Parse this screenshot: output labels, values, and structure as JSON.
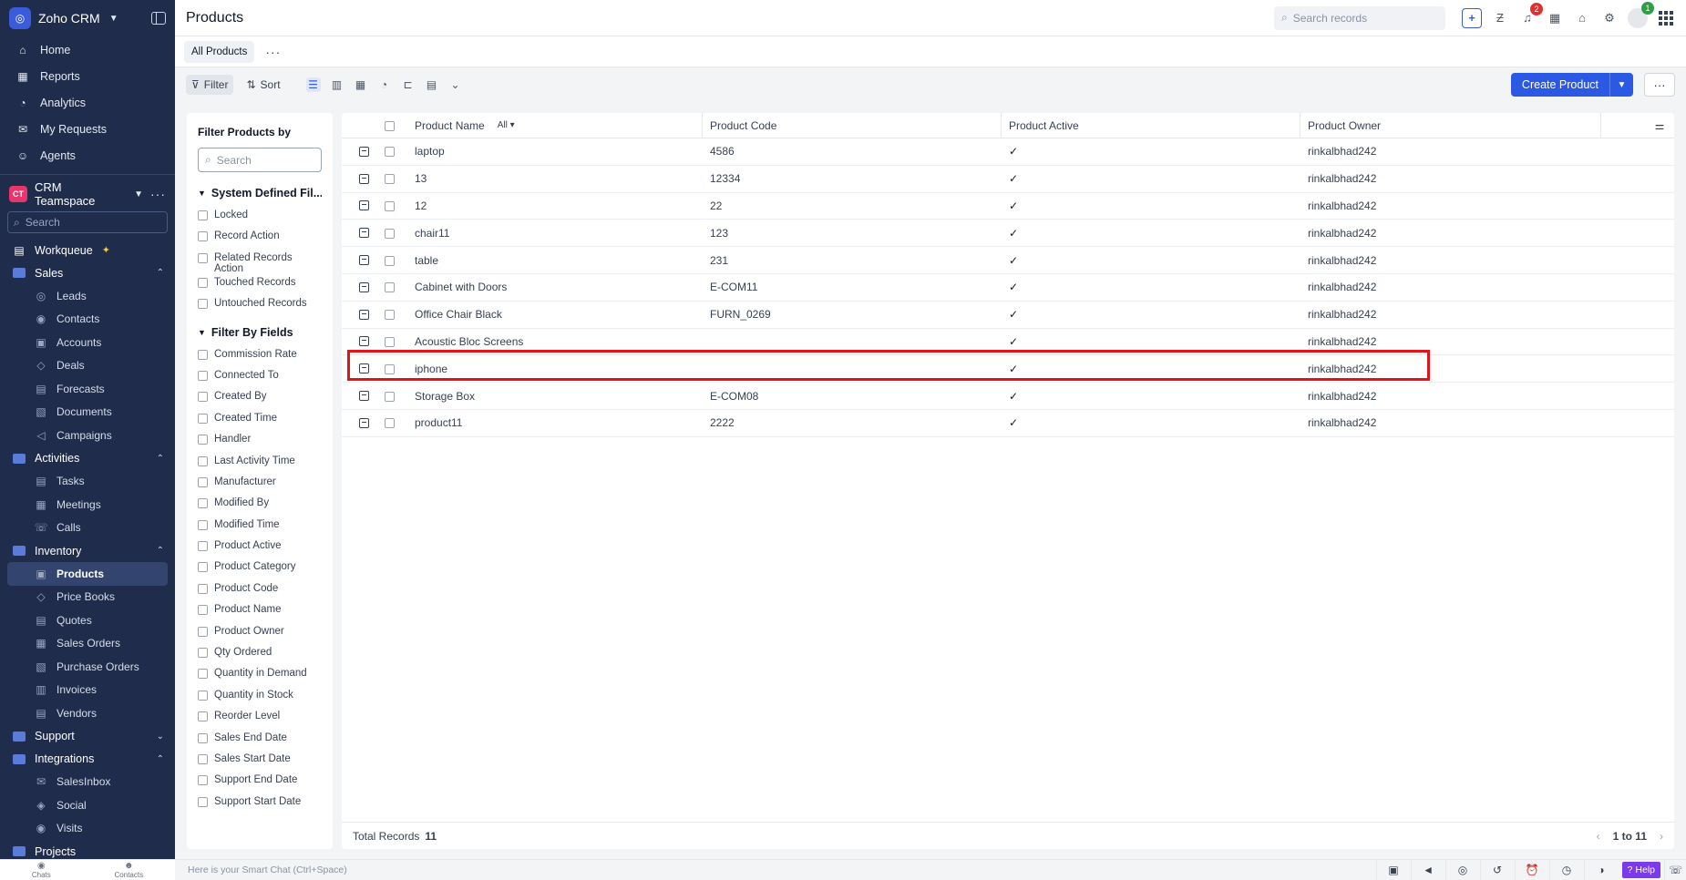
{
  "app": {
    "name": "Zoho CRM"
  },
  "sidebar": {
    "top_items": [
      {
        "label": "Home",
        "icon": "home-icon",
        "glyph": "⌂"
      },
      {
        "label": "Reports",
        "icon": "reports-icon",
        "glyph": "▦"
      },
      {
        "label": "Analytics",
        "icon": "analytics-icon",
        "glyph": "◔"
      },
      {
        "label": "My Requests",
        "icon": "requests-icon",
        "glyph": "✉"
      },
      {
        "label": "Agents",
        "icon": "agents-icon",
        "glyph": "☺"
      }
    ],
    "team": {
      "badge": "CT",
      "name": "CRM Teamspace"
    },
    "search_placeholder": "Search",
    "workqueue": "Workqueue",
    "groups": {
      "sales": {
        "label": "Sales",
        "items": [
          "Leads",
          "Contacts",
          "Accounts",
          "Deals",
          "Forecasts",
          "Documents",
          "Campaigns"
        ]
      },
      "activities": {
        "label": "Activities",
        "items": [
          "Tasks",
          "Meetings",
          "Calls"
        ]
      },
      "inventory": {
        "label": "Inventory",
        "items": [
          "Products",
          "Price Books",
          "Quotes",
          "Sales Orders",
          "Purchase Orders",
          "Invoices",
          "Vendors"
        ]
      },
      "support": {
        "label": "Support"
      },
      "integrations": {
        "label": "Integrations",
        "items": [
          "SalesInbox",
          "Social",
          "Visits"
        ]
      },
      "projects": {
        "label": "Projects"
      }
    }
  },
  "header": {
    "title": "Products",
    "search_placeholder": "Search records",
    "notification_count": "2",
    "avatar_badge": "1"
  },
  "views": {
    "current": "All Products"
  },
  "toolbar": {
    "filter": "Filter",
    "sort": "Sort",
    "create": "Create Product"
  },
  "filters": {
    "title": "Filter Products by",
    "search_placeholder": "Search",
    "system_title": "System Defined Fil...",
    "system_items": [
      "Locked",
      "Record Action",
      "Related Records Action",
      "Touched Records",
      "Untouched Records"
    ],
    "fields_title": "Filter By Fields",
    "field_items": [
      "Commission Rate",
      "Connected To",
      "Created By",
      "Created Time",
      "Handler",
      "Last Activity Time",
      "Manufacturer",
      "Modified By",
      "Modified Time",
      "Product Active",
      "Product Category",
      "Product Code",
      "Product Name",
      "Product Owner",
      "Qty Ordered",
      "Quantity in Demand",
      "Quantity in Stock",
      "Reorder Level",
      "Sales End Date",
      "Sales Start Date",
      "Support End Date",
      "Support Start Date"
    ]
  },
  "table": {
    "columns": {
      "name": "Product Name",
      "name_filter": "All",
      "code": "Product Code",
      "active": "Product Active",
      "owner": "Product Owner"
    },
    "rows": [
      {
        "name": "laptop",
        "code": "4586",
        "active": "✓",
        "owner": "rinkalbhad242"
      },
      {
        "name": "13",
        "code": "12334",
        "active": "✓",
        "owner": "rinkalbhad242"
      },
      {
        "name": "12",
        "code": "22",
        "active": "✓",
        "owner": "rinkalbhad242"
      },
      {
        "name": "chair11",
        "code": "123",
        "active": "✓",
        "owner": "rinkalbhad242"
      },
      {
        "name": "table",
        "code": "231",
        "active": "✓",
        "owner": "rinkalbhad242"
      },
      {
        "name": "Cabinet with Doors",
        "code": "E-COM11",
        "active": "✓",
        "owner": "rinkalbhad242"
      },
      {
        "name": "Office Chair Black",
        "code": "FURN_0269",
        "active": "✓",
        "owner": "rinkalbhad242"
      },
      {
        "name": "Acoustic Bloc Screens",
        "code": "",
        "active": "✓",
        "owner": "rinkalbhad242"
      },
      {
        "name": "iphone",
        "code": "",
        "active": "✓",
        "owner": "rinkalbhad242"
      },
      {
        "name": "Storage Box",
        "code": "E-COM08",
        "active": "✓",
        "owner": "rinkalbhad242"
      },
      {
        "name": "product11",
        "code": "2222",
        "active": "✓",
        "owner": "rinkalbhad242"
      }
    ],
    "footer": {
      "total_label": "Total Records",
      "total": "11",
      "range": "1 to 11"
    }
  },
  "bottom": {
    "chats": "Chats",
    "contacts": "Contacts",
    "smart_chat_placeholder": "Here is your Smart Chat (Ctrl+Space)",
    "help": "Help"
  },
  "colors": {
    "sidebar": "#1f2c4b",
    "accent": "#2b59e3",
    "highlight": "#e3131b"
  }
}
